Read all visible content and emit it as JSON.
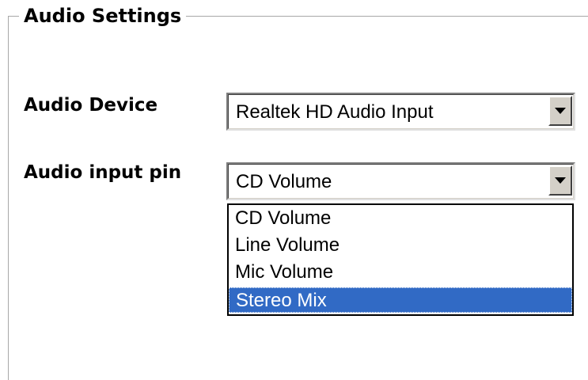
{
  "groupbox": {
    "title": "Audio Settings"
  },
  "audio_device": {
    "label": "Audio Device",
    "value": "Realtek HD Audio Input"
  },
  "audio_input_pin": {
    "label": "Audio input pin",
    "value": "CD Volume",
    "options": [
      "CD Volume",
      "Line Volume",
      "Mic Volume",
      "Stereo Mix"
    ],
    "highlighted_option": "Stereo Mix"
  },
  "colors": {
    "selection": "#316ac5",
    "button_face": "#d4d0c8",
    "frame": "#a8a8a8"
  },
  "icons": {
    "dropdown_arrow": "chevron-down-icon"
  }
}
